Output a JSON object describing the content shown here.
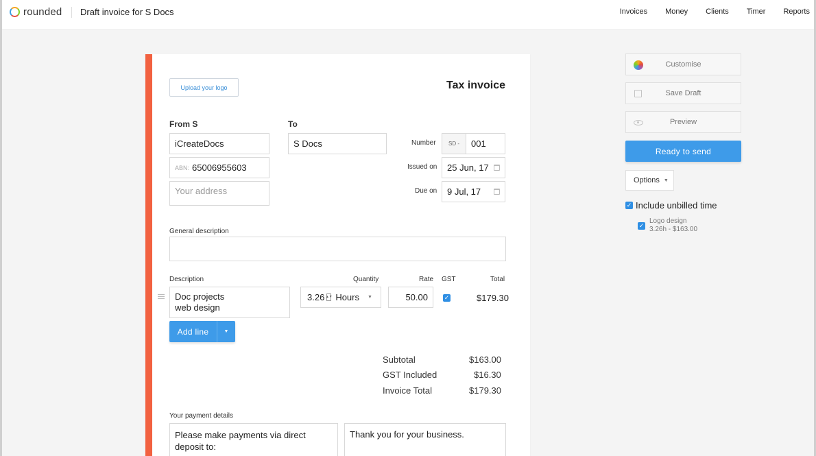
{
  "brand": {
    "name": "rounded"
  },
  "header": {
    "title": "Draft invoice for S Docs"
  },
  "nav": [
    "Invoices",
    "Money",
    "Clients",
    "Timer",
    "Reports"
  ],
  "invoice": {
    "upload_logo": "Upload your logo",
    "doc_type": "Tax invoice",
    "from_label": "From S",
    "to_label": "To",
    "from_name": "iCreateDocs",
    "abn_prefix": "ABN:",
    "abn": "65006955603",
    "address_placeholder": "Your address",
    "to_name": "S Docs",
    "number_label": "Number",
    "number_prefix": "SD -",
    "number": "001",
    "issued_label": "Issued on",
    "issued": "25 Jun, 17",
    "due_label": "Due on",
    "due": "9 Jul, 17",
    "general_description_label": "General description",
    "general_description": "",
    "columns": {
      "description": "Description",
      "quantity": "Quantity",
      "rate": "Rate",
      "gst": "GST",
      "total": "Total"
    },
    "line": {
      "description_1": "Doc projects",
      "description_2": "web design",
      "quantity": "3.26",
      "unit": "Hours",
      "rate": "50.00",
      "gst_checked": true,
      "total": "$179.30"
    },
    "add_line": "Add line",
    "totals": [
      {
        "label": "Subtotal",
        "value": "$163.00"
      },
      {
        "label": "GST Included",
        "value": "$16.30"
      },
      {
        "label": "Invoice Total",
        "value": "$179.30"
      }
    ],
    "payment_label": "Your payment details",
    "payment_text_1": "Please make payments via direct",
    "payment_text_2": "deposit to:",
    "notes_text": "Thank you for your business."
  },
  "sidebar": {
    "customise": "Customise",
    "save_draft": "Save Draft",
    "preview": "Preview",
    "ready": "Ready to send",
    "options": "Options",
    "include_unbilled": "Include unbilled time",
    "unbilled_item": {
      "name": "Logo design",
      "detail": "3.26h  - $163.00"
    }
  },
  "colors": {
    "accent": "#f26140",
    "primary": "#3e9be9"
  }
}
